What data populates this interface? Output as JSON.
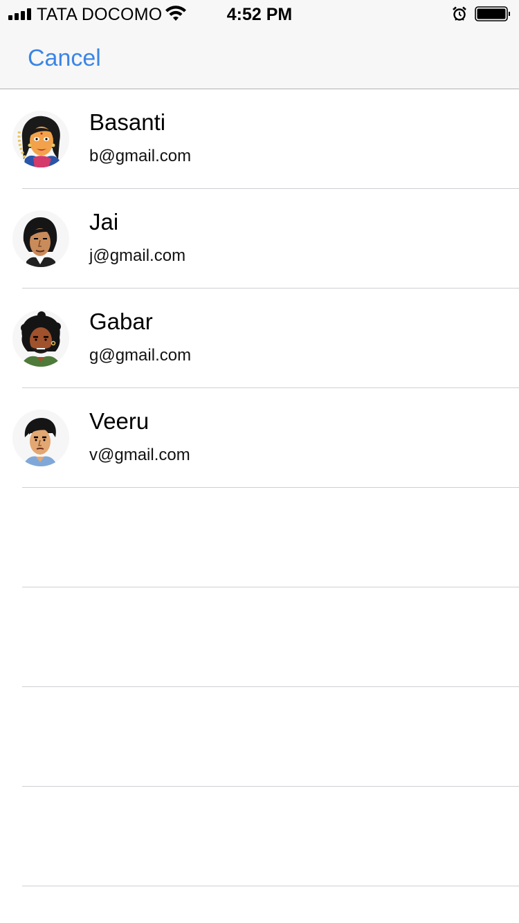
{
  "status_bar": {
    "carrier": "TATA DOCOMO",
    "time": "4:52 PM",
    "icons": [
      "signal-icon",
      "wifi-icon",
      "alarm-icon",
      "battery-icon"
    ]
  },
  "nav": {
    "cancel_label": "Cancel"
  },
  "colors": {
    "accent": "#3a85e6",
    "separator": "#cfcfd3",
    "nav_background": "#f7f7f7"
  },
  "contacts": [
    {
      "name": "Basanti",
      "email": "b@gmail.com",
      "avatar": "basanti-avatar"
    },
    {
      "name": "Jai",
      "email": "j@gmail.com",
      "avatar": "jai-avatar"
    },
    {
      "name": "Gabar",
      "email": "g@gmail.com",
      "avatar": "gabar-avatar"
    },
    {
      "name": "Veeru",
      "email": "v@gmail.com",
      "avatar": "veeru-avatar"
    }
  ]
}
